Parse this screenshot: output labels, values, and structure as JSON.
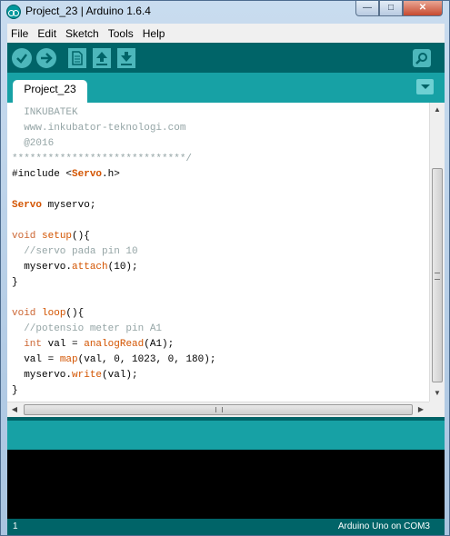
{
  "window": {
    "title": "Project_23 | Arduino 1.6.4"
  },
  "menu": [
    "File",
    "Edit",
    "Sketch",
    "Tools",
    "Help"
  ],
  "toolbar": {
    "verify": "check-icon",
    "upload": "arrow-right-icon",
    "new": "new-file-icon",
    "open": "open-arrow-up-icon",
    "save": "save-arrow-down-icon",
    "serial_monitor": "magnifier-icon"
  },
  "tabs": [
    {
      "label": "Project_23"
    }
  ],
  "code_lines": [
    [
      {
        "t": "  INKUBATEK",
        "c": "c-comment"
      }
    ],
    [
      {
        "t": "  www.inkubator-teknologi.com",
        "c": "c-comment"
      }
    ],
    [
      {
        "t": "  @2016",
        "c": "c-comment"
      }
    ],
    [
      {
        "t": "*****************************/",
        "c": "c-comment"
      }
    ],
    [
      {
        "t": "#include <",
        "c": "c-plain"
      },
      {
        "t": "Servo",
        "c": "c-class"
      },
      {
        "t": ".h>",
        "c": "c-plain"
      }
    ],
    [
      {
        "t": "",
        "c": "c-plain"
      }
    ],
    [
      {
        "t": "Servo",
        "c": "c-class"
      },
      {
        "t": " myservo;",
        "c": "c-plain"
      }
    ],
    [
      {
        "t": "",
        "c": "c-plain"
      }
    ],
    [
      {
        "t": "void",
        "c": "c-type"
      },
      {
        "t": " ",
        "c": "c-plain"
      },
      {
        "t": "setup",
        "c": "c-fn"
      },
      {
        "t": "(){",
        "c": "c-plain"
      }
    ],
    [
      {
        "t": "  //servo pada pin 10",
        "c": "c-comment"
      }
    ],
    [
      {
        "t": "  myservo.",
        "c": "c-plain"
      },
      {
        "t": "attach",
        "c": "c-fn"
      },
      {
        "t": "(10);",
        "c": "c-plain"
      }
    ],
    [
      {
        "t": "}",
        "c": "c-plain"
      }
    ],
    [
      {
        "t": "",
        "c": "c-plain"
      }
    ],
    [
      {
        "t": "void",
        "c": "c-type"
      },
      {
        "t": " ",
        "c": "c-plain"
      },
      {
        "t": "loop",
        "c": "c-fn"
      },
      {
        "t": "(){",
        "c": "c-plain"
      }
    ],
    [
      {
        "t": "  //potensio meter pin A1",
        "c": "c-comment"
      }
    ],
    [
      {
        "t": "  ",
        "c": "c-plain"
      },
      {
        "t": "int",
        "c": "c-type"
      },
      {
        "t": " val = ",
        "c": "c-plain"
      },
      {
        "t": "analogRead",
        "c": "c-fn"
      },
      {
        "t": "(A1);",
        "c": "c-plain"
      }
    ],
    [
      {
        "t": "  val = ",
        "c": "c-plain"
      },
      {
        "t": "map",
        "c": "c-fn"
      },
      {
        "t": "(val, 0, 1023, 0, 180);",
        "c": "c-plain"
      }
    ],
    [
      {
        "t": "  myservo.",
        "c": "c-plain"
      },
      {
        "t": "write",
        "c": "c-fn"
      },
      {
        "t": "(val);",
        "c": "c-plain"
      }
    ],
    [
      {
        "t": "}",
        "c": "c-plain"
      }
    ]
  ],
  "status": {
    "line": "1",
    "board": "Arduino Uno on COM3"
  },
  "colors": {
    "toolbar": "#006468",
    "tabbar": "#17a1a5",
    "button": "#4db7bb",
    "keyword": "#cc6633",
    "function": "#d35400",
    "comment": "#95a5a6"
  }
}
